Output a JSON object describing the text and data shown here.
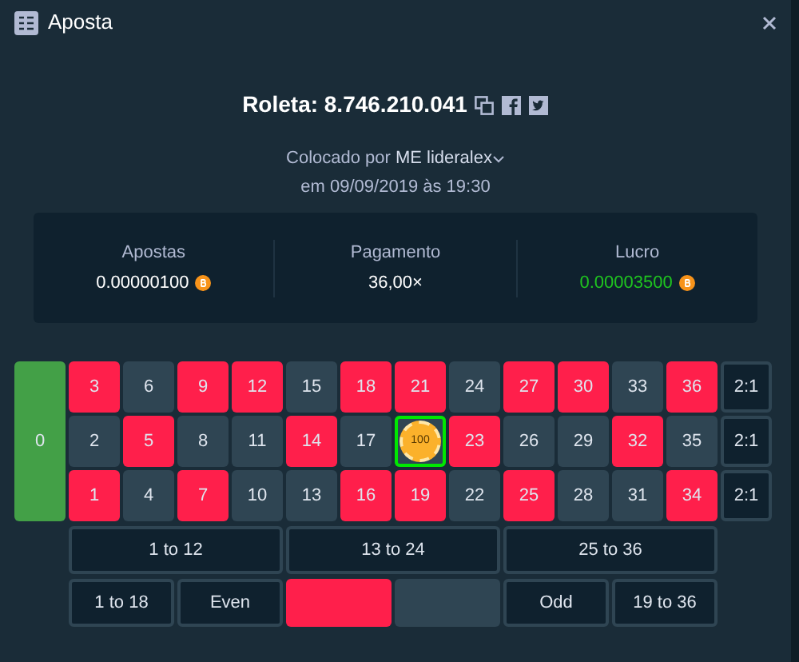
{
  "window": {
    "title": "Aposta"
  },
  "bet": {
    "title": "Roleta: 8.746.210.041",
    "placed_by": "Colocado por",
    "user": "ME lideralex",
    "date": "em 09/09/2019 às 19:30"
  },
  "stats": [
    {
      "label": "Apostas",
      "value": "0.00000100",
      "coin": true,
      "profit": false
    },
    {
      "label": "Pagamento",
      "value": "36,00×",
      "coin": false,
      "profit": false
    },
    {
      "label": "Lucro",
      "value": "0.00003500",
      "coin": true,
      "profit": true
    }
  ],
  "board": {
    "zero": {
      "label": "0",
      "color": "#43a047"
    },
    "number_rows": [
      [
        {
          "label": "3",
          "color": "#ff1f4b",
          "selected": false
        },
        {
          "label": "6",
          "color": "#2f4553",
          "selected": false
        },
        {
          "label": "9",
          "color": "#ff1f4b",
          "selected": false
        },
        {
          "label": "12",
          "color": "#ff1f4b",
          "selected": false
        },
        {
          "label": "15",
          "color": "#2f4553",
          "selected": false
        },
        {
          "label": "18",
          "color": "#ff1f4b",
          "selected": false
        },
        {
          "label": "21",
          "color": "#ff1f4b",
          "selected": false
        },
        {
          "label": "24",
          "color": "#2f4553",
          "selected": false
        },
        {
          "label": "27",
          "color": "#ff1f4b",
          "selected": false
        },
        {
          "label": "30",
          "color": "#ff1f4b",
          "selected": false
        },
        {
          "label": "33",
          "color": "#2f4553",
          "selected": false
        },
        {
          "label": "36",
          "color": "#ff1f4b",
          "selected": false
        }
      ],
      [
        {
          "label": "2",
          "color": "#2f4553",
          "selected": false
        },
        {
          "label": "5",
          "color": "#ff1f4b",
          "selected": false
        },
        {
          "label": "8",
          "color": "#2f4553",
          "selected": false
        },
        {
          "label": "11",
          "color": "#2f4553",
          "selected": false
        },
        {
          "label": "14",
          "color": "#ff1f4b",
          "selected": false
        },
        {
          "label": "17",
          "color": "#2f4553",
          "selected": false
        },
        {
          "chip": "100",
          "color": "#2f4553",
          "selected": true
        },
        {
          "label": "23",
          "color": "#ff1f4b",
          "selected": false
        },
        {
          "label": "26",
          "color": "#2f4553",
          "selected": false
        },
        {
          "label": "29",
          "color": "#2f4553",
          "selected": false
        },
        {
          "label": "32",
          "color": "#ff1f4b",
          "selected": false
        },
        {
          "label": "35",
          "color": "#2f4553",
          "selected": false
        }
      ],
      [
        {
          "label": "1",
          "color": "#ff1f4b",
          "selected": false
        },
        {
          "label": "4",
          "color": "#2f4553",
          "selected": false
        },
        {
          "label": "7",
          "color": "#ff1f4b",
          "selected": false
        },
        {
          "label": "10",
          "color": "#2f4553",
          "selected": false
        },
        {
          "label": "13",
          "color": "#2f4553",
          "selected": false
        },
        {
          "label": "16",
          "color": "#ff1f4b",
          "selected": false
        },
        {
          "label": "19",
          "color": "#ff1f4b",
          "selected": false
        },
        {
          "label": "22",
          "color": "#2f4553",
          "selected": false
        },
        {
          "label": "25",
          "color": "#ff1f4b",
          "selected": false
        },
        {
          "label": "28",
          "color": "#2f4553",
          "selected": false
        },
        {
          "label": "31",
          "color": "#2f4553",
          "selected": false
        },
        {
          "label": "34",
          "color": "#ff1f4b",
          "selected": false
        }
      ]
    ],
    "columns": [
      "2:1",
      "2:1",
      "2:1"
    ],
    "dozens": [
      "1 to 12",
      "13 to 24",
      "25 to 36"
    ],
    "outside": [
      {
        "kind": "text",
        "label": "1 to 18"
      },
      {
        "kind": "text",
        "label": "Even"
      },
      {
        "kind": "color",
        "color": "#ff1f4b"
      },
      {
        "kind": "color",
        "color": "#2f4553"
      },
      {
        "kind": "text",
        "label": "Odd"
      },
      {
        "kind": "text",
        "label": "19 to 36"
      }
    ]
  }
}
